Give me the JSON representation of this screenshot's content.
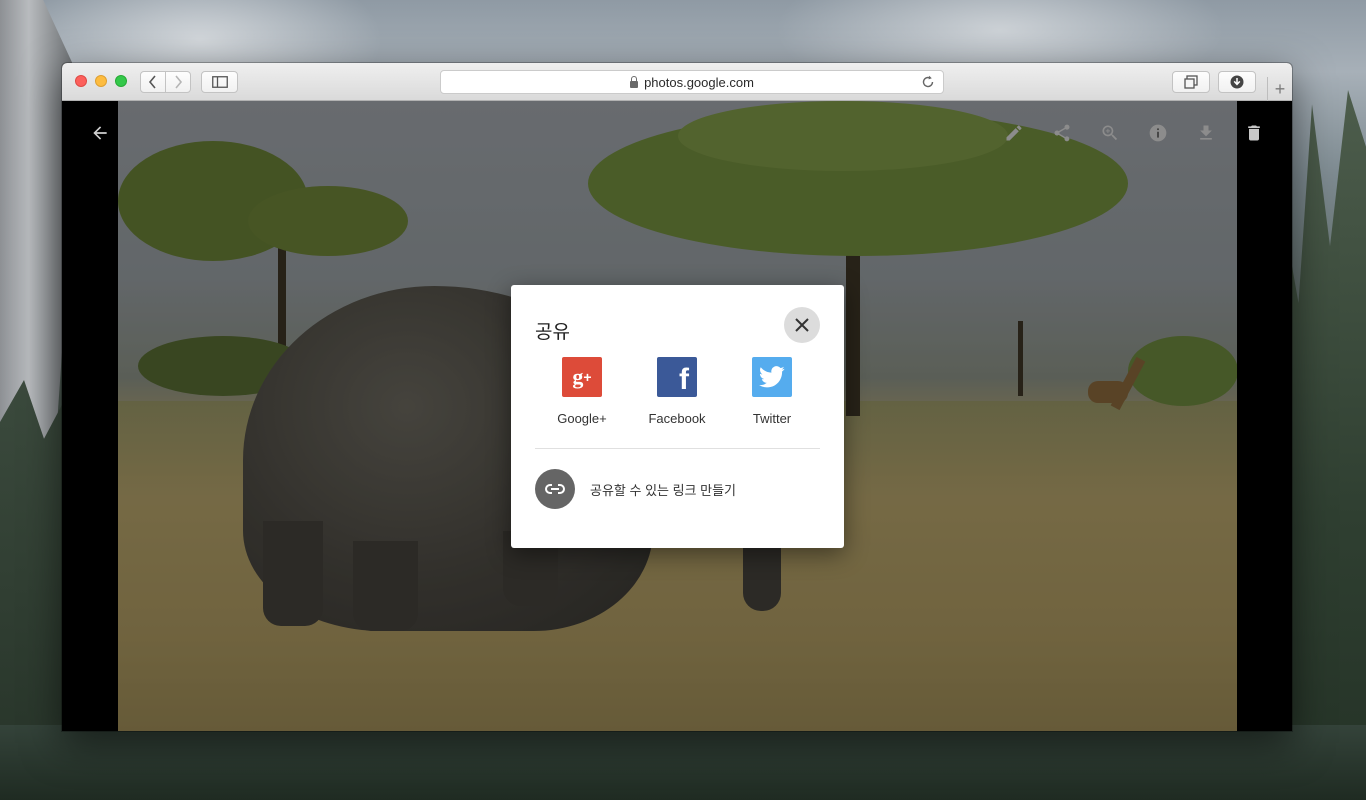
{
  "window": {
    "address": "photos.google.com"
  },
  "viewer": {
    "toolbar_icons": [
      "back-icon",
      "edit-icon",
      "share-icon",
      "zoom-icon",
      "info-icon",
      "download-icon",
      "delete-icon"
    ]
  },
  "share_dialog": {
    "title": "공유",
    "targets": [
      {
        "label": "Google+",
        "icon": "google-plus-icon",
        "color": "#dd4b39"
      },
      {
        "label": "Facebook",
        "icon": "facebook-icon",
        "color": "#3b5998"
      },
      {
        "label": "Twitter",
        "icon": "twitter-icon",
        "color": "#55acee"
      }
    ],
    "create_link_label": "공유할 수 있는 링크 만들기"
  }
}
